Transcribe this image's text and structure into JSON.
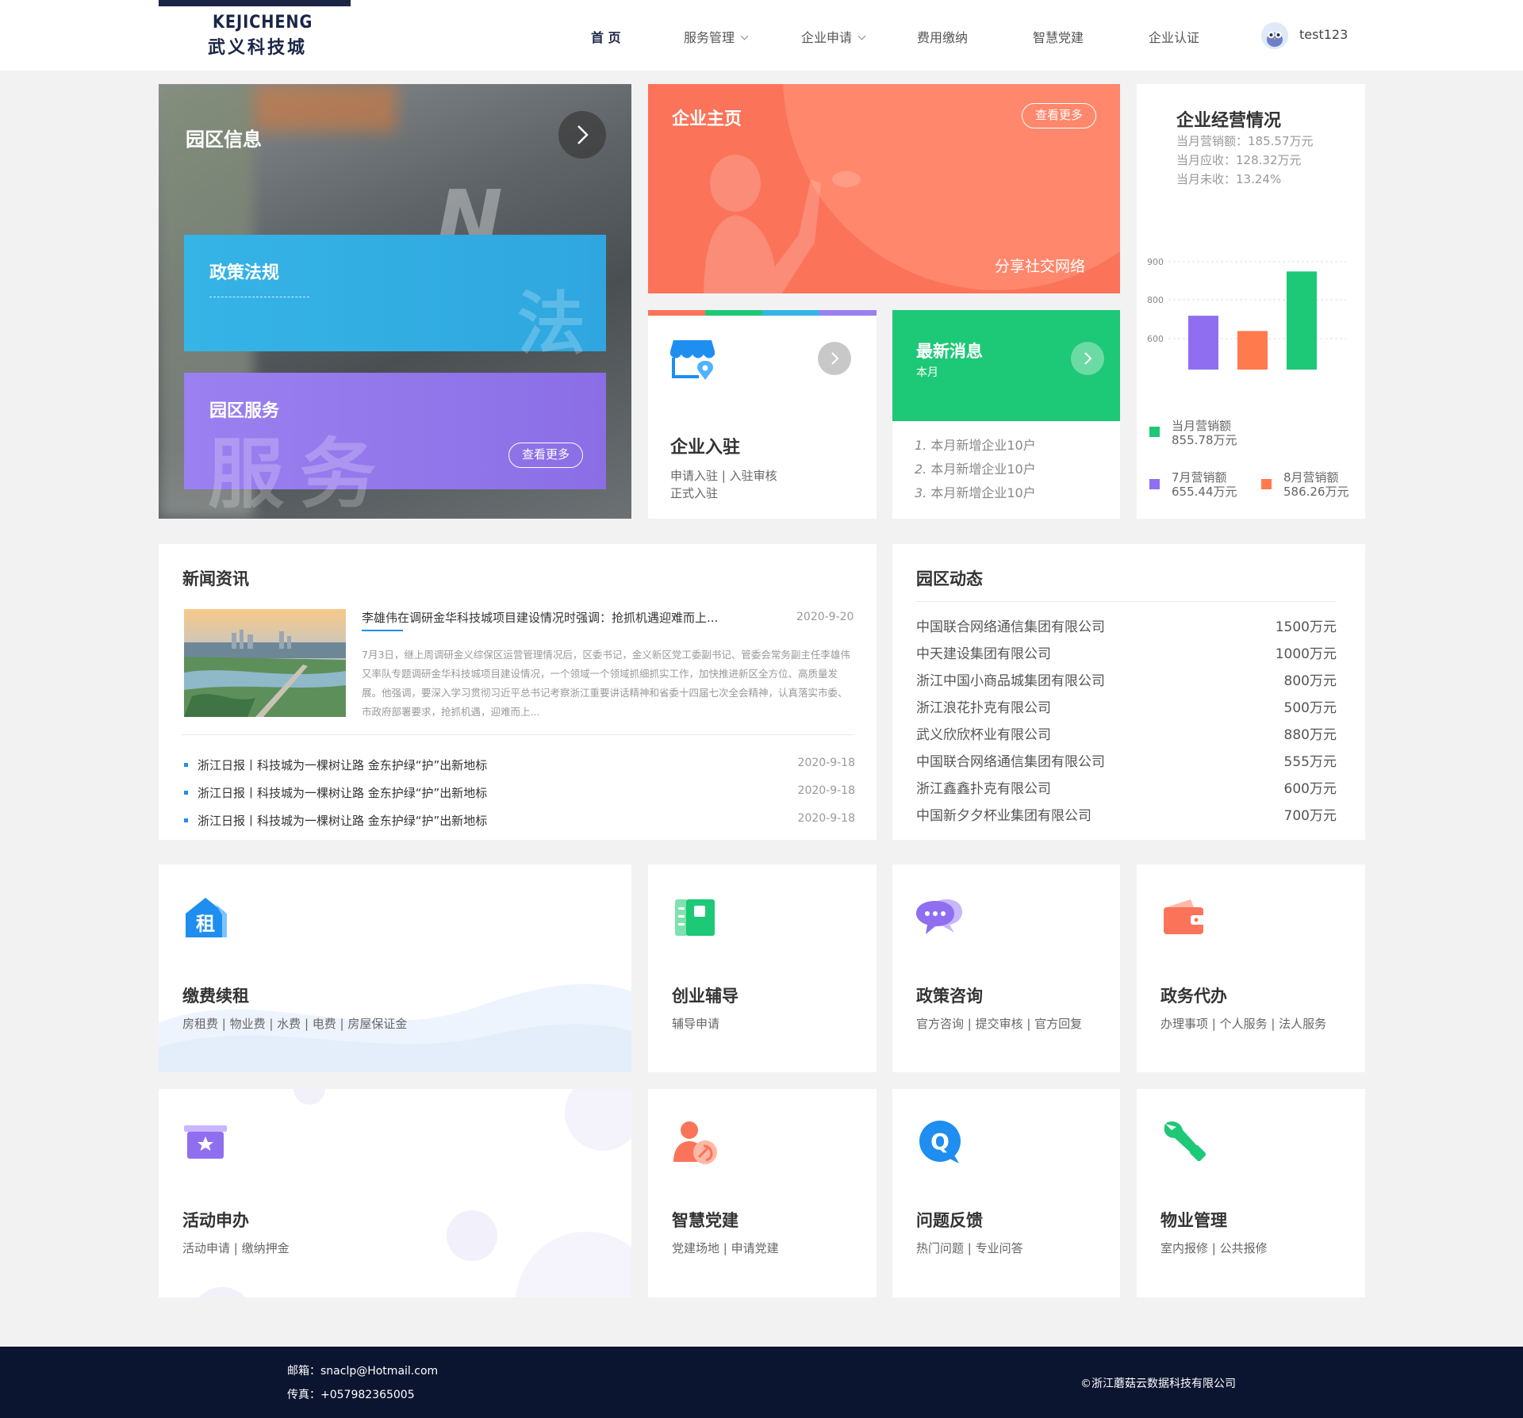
{
  "header": {
    "logo_en": "KEJICHENG",
    "logo_cn": "武义科技城",
    "nav": [
      {
        "label": "首 页"
      },
      {
        "label": "服务管理"
      },
      {
        "label": "企业申请"
      },
      {
        "label": "费用缴纳"
      },
      {
        "label": "智慧党建"
      },
      {
        "label": "企业认证"
      }
    ],
    "username": "test123"
  },
  "park": {
    "title": "园区信息",
    "policy_title": "政策法规",
    "policy_ghost": "法",
    "service_title": "园区服务",
    "service_ghost": "服务",
    "service_more": "查看更多"
  },
  "home": {
    "title": "企业主页",
    "more": "查看更多",
    "tagline": "分享社交网络"
  },
  "join": {
    "title": "企业入驻",
    "line1": "申请入驻 | 入驻审核",
    "line2": "正式入驻"
  },
  "latest": {
    "title": "最新消息",
    "subtitle": "本月",
    "items": [
      {
        "num": "1.",
        "text": "本月新增企业10户"
      },
      {
        "num": "2.",
        "text": "本月新增企业10户"
      },
      {
        "num": "3.",
        "text": "本月新增企业10户"
      }
    ]
  },
  "business": {
    "title": "企业经营情况",
    "stats": [
      "当月营销额：185.57万元",
      "当月应收：128.32万元",
      "当月未收：13.24%"
    ],
    "legend": [
      {
        "label": "当月营销额",
        "value": "855.78万元",
        "color": "#1dc876"
      },
      {
        "label": "7月营销额",
        "value": "655.44万元",
        "color": "#8f6ff0"
      },
      {
        "label": "8月营销额",
        "value": "586.26万元",
        "color": "#ff7a4d"
      }
    ]
  },
  "chart_data": {
    "type": "bar",
    "categories": [
      "7月",
      "8月",
      "当月"
    ],
    "values": [
      655.44,
      586.26,
      855.78
    ],
    "colors": [
      "#8f6ff0",
      "#ff7a4d",
      "#1dc876"
    ],
    "yticks": [
      "900",
      "800",
      "600",
      "400",
      "200"
    ],
    "ylim": [
      200,
      900
    ],
    "grid": true
  },
  "news": {
    "title": "新闻资讯",
    "featured": {
      "headline": "李雄伟在调研金华科技城项目建设情况时强调：抢抓机遇迎难而上...",
      "date": "2020-9-20",
      "body": "7月3日，继上周调研金义综保区运营管理情况后，区委书记，金义新区党工委副书记、管委会常务副主任李雄伟又率队专题调研金华科技城项目建设情况，一个领域一个领域抓细抓实工作，加快推进新区全方位、高质量发展。他强调，要深入学习贯彻习近平总书记考察浙江重要讲话精神和省委十四届七次全会精神，认真落实市委、市政府部署要求，抢抓机遇，迎难而上..."
    },
    "items": [
      {
        "text": "浙江日报丨科技城为一棵树让路 金东护绿“护”出新地标",
        "date": "2020-9-18"
      },
      {
        "text": "浙江日报丨科技城为一棵树让路 金东护绿“护”出新地标",
        "date": "2020-9-18"
      },
      {
        "text": "浙江日报丨科技城为一棵树让路 金东护绿“护”出新地标",
        "date": "2020-9-18"
      }
    ]
  },
  "dynamics": {
    "title": "园区动态",
    "items": [
      {
        "name": "中国联合网络通信集团有限公司",
        "amount": "1500万元"
      },
      {
        "name": "中天建设集团有限公司",
        "amount": "1000万元"
      },
      {
        "name": "浙江中国小商品城集团有限公司",
        "amount": "800万元"
      },
      {
        "name": "浙江浪花扑克有限公司",
        "amount": "500万元"
      },
      {
        "name": "武义欣欣杯业有限公司",
        "amount": "880万元"
      },
      {
        "name": "中国联合网络通信集团有限公司",
        "amount": "555万元"
      },
      {
        "name": "浙江鑫鑫扑克有限公司",
        "amount": "600万元"
      },
      {
        "name": "中国新夕夕杯业集团有限公司",
        "amount": "700万元"
      }
    ]
  },
  "services": [
    {
      "title": "缴费续租",
      "sub": "房租费 | 物业费 | 水费 | 电费 | 房屋保证金",
      "icon_char": "租"
    },
    {
      "title": "创业辅导",
      "sub": "辅导申请"
    },
    {
      "title": "政策咨询",
      "sub": "官方咨询 | 提交审核 | 官方回复"
    },
    {
      "title": "政务代办",
      "sub": "办理事项 | 个人服务 | 法人服务"
    },
    {
      "title": "活动申办",
      "sub": "活动申请 | 缴纳押金"
    },
    {
      "title": "智慧党建",
      "sub": "党建场地 | 申请党建"
    },
    {
      "title": "问题反馈",
      "sub": "热门问题 | 专业问答",
      "icon_char": "Q"
    },
    {
      "title": "物业管理",
      "sub": "室内报修 | 公共报修"
    }
  ],
  "footer": {
    "email": "邮箱：snaclp@Hotmail.com",
    "fax": "传真：+057982365005",
    "copyright": "©浙江蘑菇云数据科技有限公司"
  }
}
